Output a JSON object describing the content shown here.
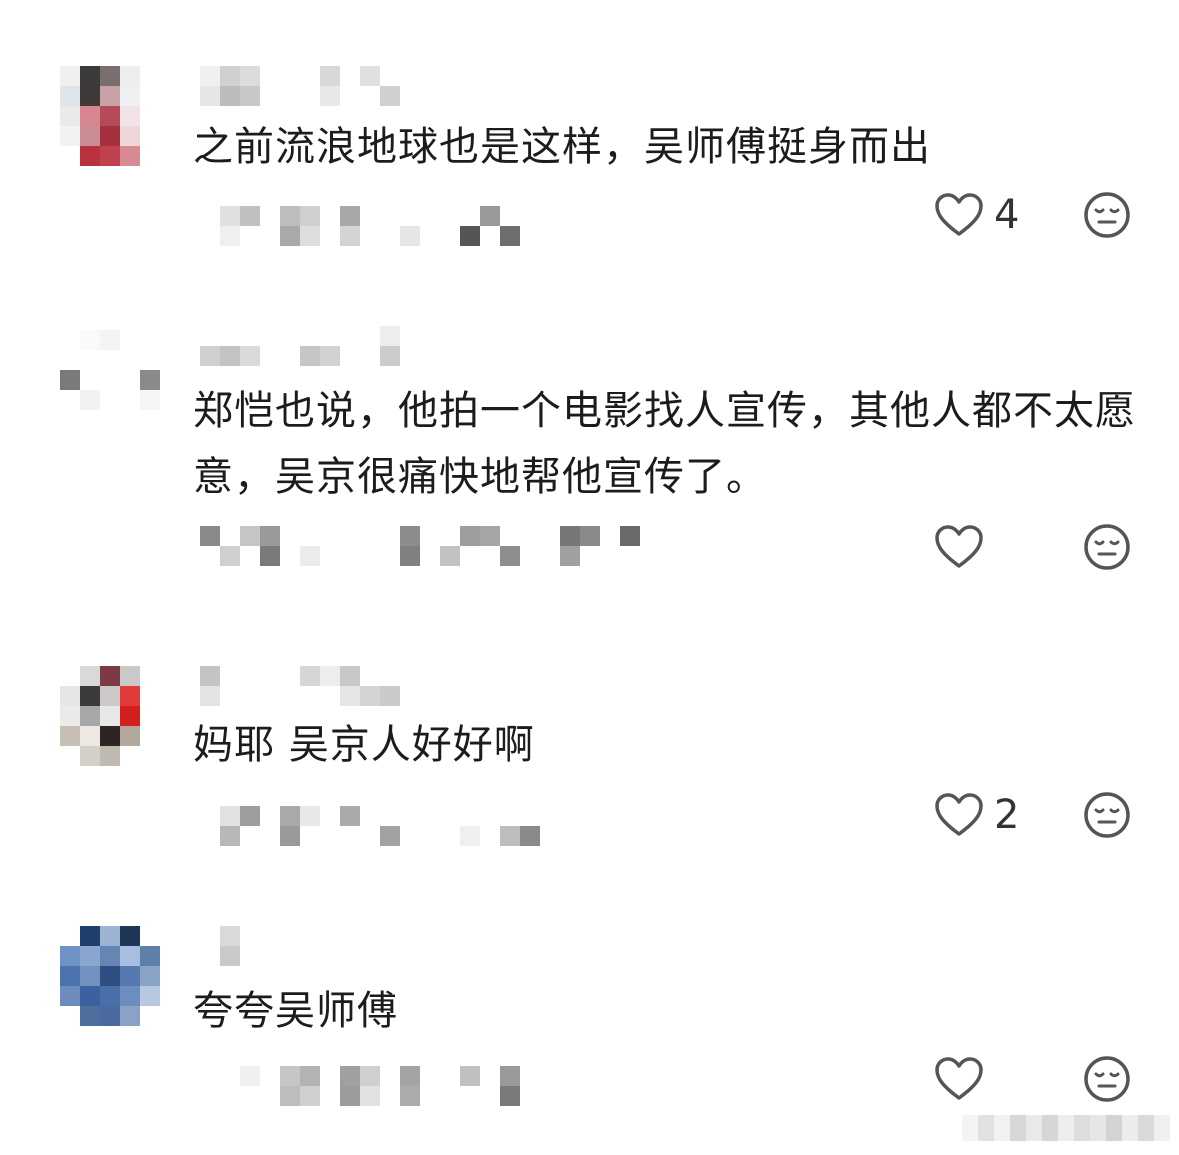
{
  "comments": [
    {
      "text": "之前流浪地球也是这样，吴师傅挺身而出",
      "like_count": "4"
    },
    {
      "text": "郑恺也说，他拍一个电影找人宣传，其他人都不太愿意，吴京很痛快地帮他宣传了。",
      "like_count": ""
    },
    {
      "text": "妈耶 吴京人好好啊",
      "like_count": "2"
    },
    {
      "text": "夸夸吴师傅",
      "like_count": ""
    }
  ],
  "icons": {
    "like": "heart-outline-icon",
    "reaction": "neutral-face-icon"
  },
  "colors": {
    "text": "#1c1c1c",
    "icon": "#555555",
    "background": "#ffffff"
  }
}
